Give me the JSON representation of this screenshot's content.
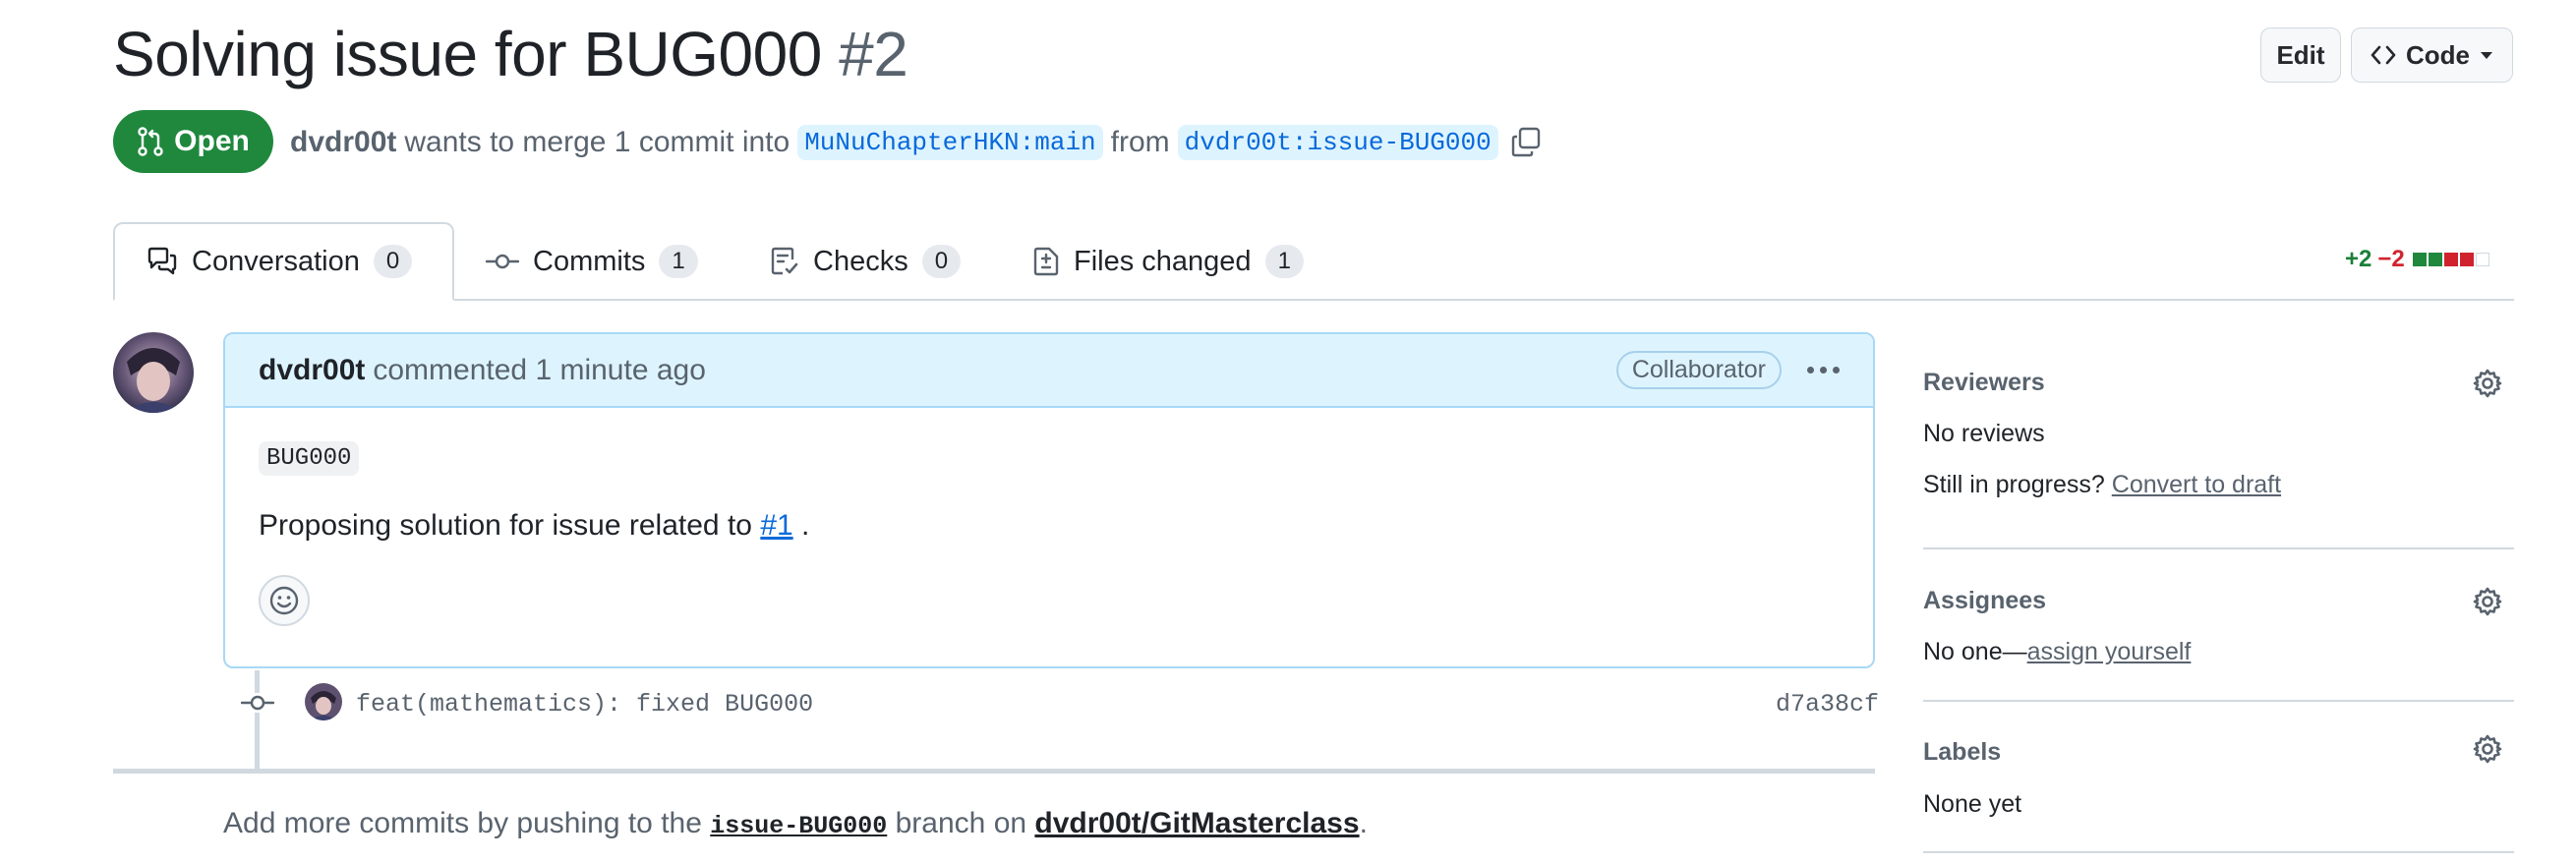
{
  "header": {
    "title": "Solving issue for BUG000",
    "number": "#2",
    "edit_label": "Edit",
    "code_label": "Code",
    "state": "Open",
    "author": "dvdr00t",
    "merge_text": "wants to merge 1 commit into",
    "base_branch": "MuNuChapterHKN:main",
    "from_text": "from",
    "head_branch": "dvdr00t:issue-BUG000"
  },
  "tabs": [
    {
      "label": "Conversation",
      "count": "0"
    },
    {
      "label": "Commits",
      "count": "1"
    },
    {
      "label": "Checks",
      "count": "0"
    },
    {
      "label": "Files changed",
      "count": "1"
    }
  ],
  "diffstat": {
    "additions": "+2",
    "deletions": "−2"
  },
  "comment": {
    "author": "dvdr00t",
    "action": "commented 1 minute ago",
    "badge": "Collaborator",
    "code": "BUG000",
    "text_before": "Proposing solution for issue related to",
    "link": "#1",
    "text_after": "."
  },
  "commit": {
    "message": "feat(mathematics): fixed BUG000",
    "sha": "d7a38cf"
  },
  "push_note": {
    "prefix": "Add more commits by pushing to the",
    "branch": "issue-BUG000",
    "middle": "branch on",
    "repo": "dvdr00t/GitMasterclass",
    "suffix": "."
  },
  "sidebar": {
    "reviewers": {
      "title": "Reviewers",
      "value": "No reviews",
      "progress": "Still in progress?",
      "convert": "Convert to draft"
    },
    "assignees": {
      "title": "Assignees",
      "prefix": "No one—",
      "assign": "assign yourself"
    },
    "labels": {
      "title": "Labels",
      "value": "None yet"
    }
  },
  "colors": {
    "open_green": "#1f883d",
    "link_blue": "#0969da",
    "branch_bg": "#ddf4ff",
    "comment_header_bg": "#ddf4ff",
    "addition_green": "#1a7f37",
    "deletion_red": "#d1242f"
  }
}
